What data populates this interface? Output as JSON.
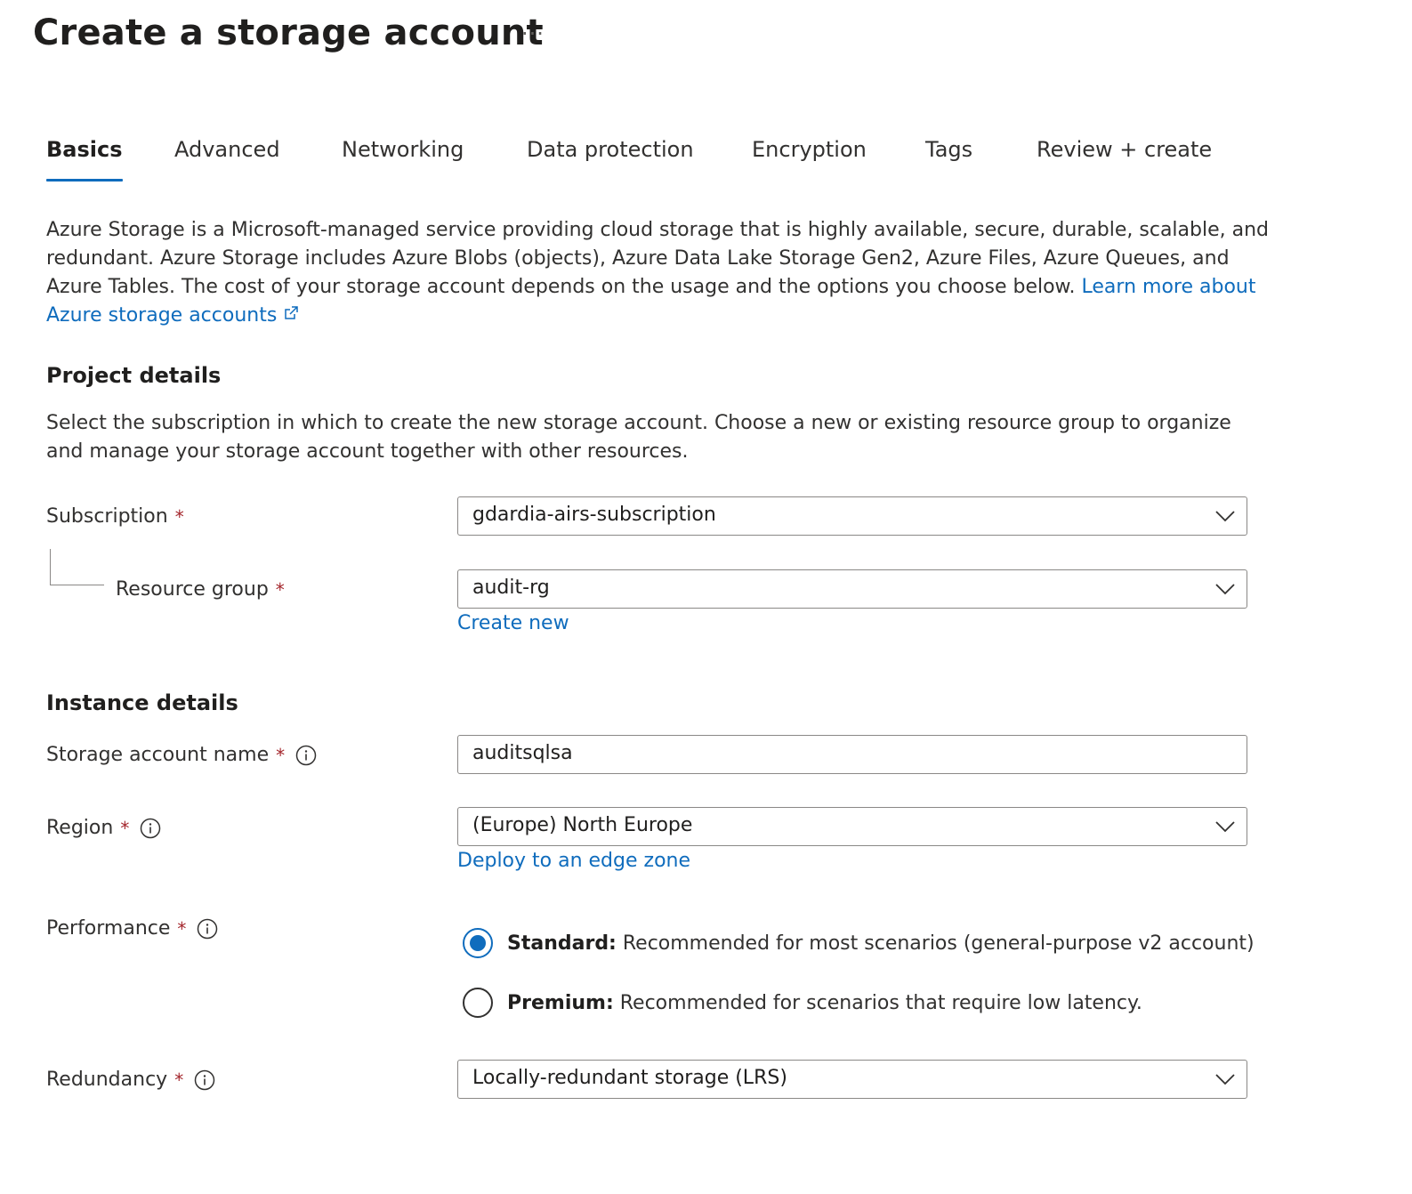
{
  "page": {
    "title": "Create a storage account",
    "more_actions": "···"
  },
  "tabs": [
    {
      "label": "Basics",
      "active": true
    },
    {
      "label": "Advanced",
      "active": false
    },
    {
      "label": "Networking",
      "active": false
    },
    {
      "label": "Data protection",
      "active": false
    },
    {
      "label": "Encryption",
      "active": false
    },
    {
      "label": "Tags",
      "active": false
    },
    {
      "label": "Review + create",
      "active": false
    }
  ],
  "intro": {
    "text": "Azure Storage is a Microsoft-managed service providing cloud storage that is highly available, secure, durable, scalable, and redundant. Azure Storage includes Azure Blobs (objects), Azure Data Lake Storage Gen2, Azure Files, Azure Queues, and Azure Tables. The cost of your storage account depends on the usage and the options you choose below.",
    "link": "Learn more about Azure storage accounts"
  },
  "project": {
    "title": "Project details",
    "description": "Select the subscription in which to create the new storage account. Choose a new or existing resource group to organize and manage your storage account together with other resources.",
    "subscription_label": "Subscription",
    "subscription_value": "gdardia-airs-subscription",
    "resource_group_label": "Resource group",
    "resource_group_value": "audit-rg",
    "create_new": "Create new"
  },
  "instance": {
    "title": "Instance details",
    "name_label": "Storage account name",
    "name_value": "auditsqlsa",
    "region_label": "Region",
    "region_value": "(Europe) North Europe",
    "edge_zone_link": "Deploy to an edge zone",
    "performance_label": "Performance",
    "performance_options": [
      {
        "title": "Standard:",
        "desc": "Recommended for most scenarios (general-purpose v2 account)",
        "checked": true
      },
      {
        "title": "Premium:",
        "desc": "Recommended for scenarios that require low latency.",
        "checked": false
      }
    ],
    "redundancy_label": "Redundancy",
    "redundancy_value": "Locally-redundant storage (LRS)"
  },
  "required_marker": "*",
  "colors": {
    "accent": "#0f6cbd",
    "required": "#a4262c",
    "border": "#8a8886"
  }
}
